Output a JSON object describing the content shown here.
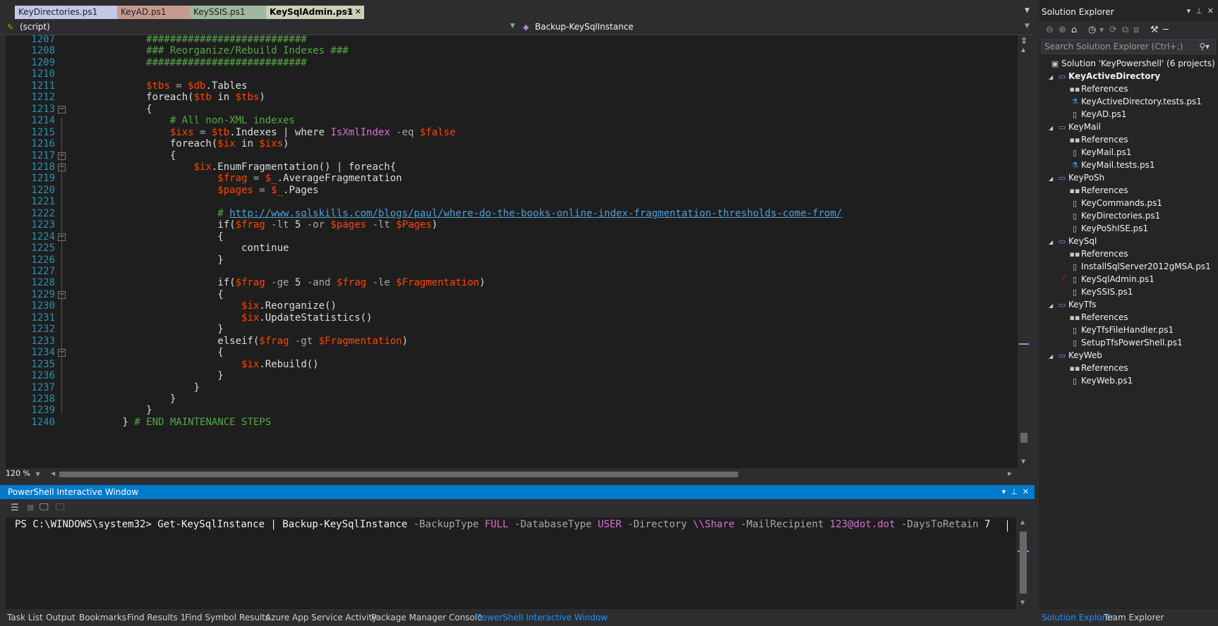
{
  "tabs": [
    {
      "label": "KeyDirectories.ps1",
      "color": "#c2c8e6"
    },
    {
      "label": "KeyAD.ps1",
      "color": "#c79b91"
    },
    {
      "label": "KeySSIS.ps1",
      "color": "#9fb89f"
    },
    {
      "label": "KeySqlAdmin.ps1",
      "color": "#c9d1b8",
      "active": true
    }
  ],
  "navbar": {
    "left": "(script)",
    "right": "Backup-KeySqlInstance"
  },
  "editor": {
    "zoom": "120 %",
    "lines": [
      {
        "n": "1207",
        "code": [
          [
            "c-com",
            "            ###########################"
          ]
        ]
      },
      {
        "n": "1208",
        "code": [
          [
            "c-com",
            "            ### Reorganize/Rebuild Indexes ###"
          ]
        ]
      },
      {
        "n": "1209",
        "code": [
          [
            "c-com",
            "            ###########################"
          ]
        ]
      },
      {
        "n": "1210",
        "code": []
      },
      {
        "n": "1211",
        "code": [
          [
            "",
            "            "
          ],
          [
            "c-var",
            "$tbs"
          ],
          [
            "c-op",
            " = "
          ],
          [
            "c-var",
            "$db"
          ],
          [
            "",
            ".Tables"
          ]
        ]
      },
      {
        "n": "1212",
        "code": [
          [
            "",
            "            foreach("
          ],
          [
            "c-var",
            "$tb"
          ],
          [
            "",
            " in "
          ],
          [
            "c-var",
            "$tbs"
          ],
          [
            "",
            ")"
          ]
        ]
      },
      {
        "n": "1213",
        "code": [
          [
            "",
            "            {"
          ]
        ]
      },
      {
        "n": "1214",
        "code": [
          [
            "c-com",
            "                # All non-XML indexes"
          ]
        ]
      },
      {
        "n": "1215",
        "code": [
          [
            "",
            "                "
          ],
          [
            "c-var",
            "$ixs"
          ],
          [
            "c-op",
            " = "
          ],
          [
            "c-var",
            "$tb"
          ],
          [
            "",
            ".Indexes | where "
          ],
          [
            "c-ty",
            "IsXmlIndex"
          ],
          [
            "c-op",
            " -eq "
          ],
          [
            "c-var",
            "$false"
          ]
        ]
      },
      {
        "n": "1216",
        "code": [
          [
            "",
            "                foreach("
          ],
          [
            "c-var",
            "$ix"
          ],
          [
            "",
            " in "
          ],
          [
            "c-var",
            "$ixs"
          ],
          [
            "",
            ")"
          ]
        ]
      },
      {
        "n": "1217",
        "code": [
          [
            "",
            "                {"
          ]
        ]
      },
      {
        "n": "1218",
        "code": [
          [
            "",
            "                    "
          ],
          [
            "c-var",
            "$ix"
          ],
          [
            "",
            ".EnumFragmentation() | foreach{"
          ]
        ]
      },
      {
        "n": "1219",
        "code": [
          [
            "",
            "                        "
          ],
          [
            "c-var",
            "$frag"
          ],
          [
            "c-op",
            " = "
          ],
          [
            "c-var",
            "$_"
          ],
          [
            "",
            ".AverageFragmentation"
          ]
        ]
      },
      {
        "n": "1220",
        "code": [
          [
            "",
            "                        "
          ],
          [
            "c-var",
            "$pages"
          ],
          [
            "c-op",
            " = "
          ],
          [
            "c-var",
            "$_"
          ],
          [
            "",
            ".Pages"
          ]
        ]
      },
      {
        "n": "1221",
        "code": []
      },
      {
        "n": "1222",
        "code": [
          [
            "c-com",
            "                        # "
          ],
          [
            "c-url",
            "http://www.sqlskills.com/blogs/paul/where-do-the-books-online-index-fragmentation-thresholds-come-from/"
          ]
        ]
      },
      {
        "n": "1223",
        "code": [
          [
            "",
            "                        if("
          ],
          [
            "c-var",
            "$frag"
          ],
          [
            "c-op",
            " -lt "
          ],
          [
            "",
            "5"
          ],
          [
            "c-op",
            " -or "
          ],
          [
            "c-var",
            "$pages"
          ],
          [
            "c-op",
            " -lt "
          ],
          [
            "c-var",
            "$Pages"
          ],
          [
            "",
            ")"
          ]
        ]
      },
      {
        "n": "1224",
        "code": [
          [
            "",
            "                        {"
          ]
        ]
      },
      {
        "n": "1225",
        "code": [
          [
            "",
            "                            continue"
          ]
        ]
      },
      {
        "n": "1226",
        "code": [
          [
            "",
            "                        }"
          ]
        ]
      },
      {
        "n": "1227",
        "code": []
      },
      {
        "n": "1228",
        "code": [
          [
            "",
            "                        if("
          ],
          [
            "c-var",
            "$frag"
          ],
          [
            "c-op",
            " -ge "
          ],
          [
            "",
            "5"
          ],
          [
            "c-op",
            " -and "
          ],
          [
            "c-var",
            "$frag"
          ],
          [
            "c-op",
            " -le "
          ],
          [
            "c-var",
            "$Fragmentation"
          ],
          [
            "",
            ")"
          ]
        ]
      },
      {
        "n": "1229",
        "code": [
          [
            "",
            "                        {"
          ]
        ]
      },
      {
        "n": "1230",
        "code": [
          [
            "",
            "                            "
          ],
          [
            "c-var",
            "$ix"
          ],
          [
            "",
            ".Reorganize()"
          ]
        ]
      },
      {
        "n": "1231",
        "code": [
          [
            "",
            "                            "
          ],
          [
            "c-var",
            "$ix"
          ],
          [
            "",
            ".UpdateStatistics()"
          ]
        ]
      },
      {
        "n": "1232",
        "code": [
          [
            "",
            "                        }"
          ]
        ]
      },
      {
        "n": "1233",
        "code": [
          [
            "",
            "                        elseif("
          ],
          [
            "c-var",
            "$frag"
          ],
          [
            "c-op",
            " -gt "
          ],
          [
            "c-var",
            "$Fragmentation"
          ],
          [
            "",
            ")"
          ]
        ]
      },
      {
        "n": "1234",
        "code": [
          [
            "",
            "                        {"
          ]
        ]
      },
      {
        "n": "1235",
        "code": [
          [
            "",
            "                            "
          ],
          [
            "c-var",
            "$ix"
          ],
          [
            "",
            ".Rebuild()"
          ]
        ]
      },
      {
        "n": "1236",
        "code": [
          [
            "",
            "                        }"
          ]
        ]
      },
      {
        "n": "1237",
        "code": [
          [
            "",
            "                    }"
          ]
        ]
      },
      {
        "n": "1238",
        "code": [
          [
            "",
            "                }"
          ]
        ]
      },
      {
        "n": "1239",
        "code": [
          [
            "",
            "            }"
          ]
        ]
      },
      {
        "n": "1240",
        "code": [
          [
            "",
            "        } "
          ],
          [
            "c-com",
            "# END MAINTENANCE STEPS"
          ]
        ]
      }
    ]
  },
  "ps_window": {
    "title": "PowerShell Interactive Window",
    "command": [
      [
        "",
        "PS C:\\WINDOWS\\system32> Get-KeySqlInstance | Backup-KeySqlInstance "
      ],
      [
        "c-op",
        "-BackupType "
      ],
      [
        "c-ty",
        "FULL"
      ],
      [
        "c-op",
        " -DatabaseType "
      ],
      [
        "c-ty",
        "USER"
      ],
      [
        "c-op",
        " -Directory "
      ],
      [
        "c-ty",
        "\\\\Share"
      ],
      [
        "c-op",
        " -MailRecipient "
      ],
      [
        "c-ty",
        "123@dot.dot"
      ],
      [
        "c-op",
        " -DaysToRetain "
      ],
      [
        "",
        "7"
      ]
    ]
  },
  "bottom_tabs": [
    "Task List",
    "Output",
    "Bookmarks",
    "Find Results 1",
    "Find Symbol Results",
    "Azure App Service Activity",
    "Package Manager Console",
    "PowerShell Interactive Window"
  ],
  "solution_explorer": {
    "title": "Solution Explorer",
    "search_placeholder": "Search Solution Explorer (Ctrl+;)",
    "tree": [
      {
        "level": 0,
        "label": "Solution 'KeyPowershell' (6 projects)",
        "icon": "solution-icon",
        "exp": ""
      },
      {
        "level": 1,
        "label": "KeyActiveDirectory",
        "icon": "project-icon",
        "exp": "◢",
        "bold": true
      },
      {
        "level": 2,
        "label": "References",
        "icon": "references-icon",
        "exp": ""
      },
      {
        "level": 2,
        "label": "KeyActiveDirectory.tests.ps1",
        "icon": "test-icon",
        "exp": ""
      },
      {
        "level": 2,
        "label": "KeyAD.ps1",
        "icon": "script-icon",
        "exp": ""
      },
      {
        "level": 1,
        "label": "KeyMail",
        "icon": "project-icon",
        "exp": "◢"
      },
      {
        "level": 2,
        "label": "References",
        "icon": "references-icon",
        "exp": ""
      },
      {
        "level": 2,
        "label": "KeyMail.ps1",
        "icon": "script-icon",
        "exp": ""
      },
      {
        "level": 2,
        "label": "KeyMail.tests.ps1",
        "icon": "test-icon",
        "exp": ""
      },
      {
        "level": 1,
        "label": "KeyPoSh",
        "icon": "project-icon",
        "exp": "◢"
      },
      {
        "level": 2,
        "label": "References",
        "icon": "references-icon",
        "exp": ""
      },
      {
        "level": 2,
        "label": "KeyCommands.ps1",
        "icon": "script-icon",
        "exp": ""
      },
      {
        "level": 2,
        "label": "KeyDirectories.ps1",
        "icon": "script-icon",
        "exp": ""
      },
      {
        "level": 2,
        "label": "KeyPoShISE.ps1",
        "icon": "script-icon",
        "exp": ""
      },
      {
        "level": 1,
        "label": "KeySql",
        "icon": "project-icon",
        "exp": "◢"
      },
      {
        "level": 2,
        "label": "References",
        "icon": "references-icon",
        "exp": ""
      },
      {
        "level": 2,
        "label": "InstallSqlServer2012gMSA.ps1",
        "icon": "script-icon",
        "exp": ""
      },
      {
        "level": 2,
        "label": "KeySqlAdmin.ps1",
        "icon": "script-icon",
        "exp": "",
        "modified": true
      },
      {
        "level": 2,
        "label": "KeySSIS.ps1",
        "icon": "script-icon",
        "exp": ""
      },
      {
        "level": 1,
        "label": "KeyTfs",
        "icon": "project-icon",
        "exp": "◢"
      },
      {
        "level": 2,
        "label": "References",
        "icon": "references-icon",
        "exp": ""
      },
      {
        "level": 2,
        "label": "KeyTfsFileHandler.ps1",
        "icon": "script-icon",
        "exp": ""
      },
      {
        "level": 2,
        "label": "SetupTfsPowerShell.ps1",
        "icon": "script-icon",
        "exp": ""
      },
      {
        "level": 1,
        "label": "KeyWeb",
        "icon": "project-icon",
        "exp": "◢"
      },
      {
        "level": 2,
        "label": "References",
        "icon": "references-icon",
        "exp": ""
      },
      {
        "level": 2,
        "label": "KeyWeb.ps1",
        "icon": "script-icon",
        "exp": ""
      }
    ],
    "bottom_tabs": [
      "Solution Explorer",
      "Team Explorer"
    ]
  }
}
